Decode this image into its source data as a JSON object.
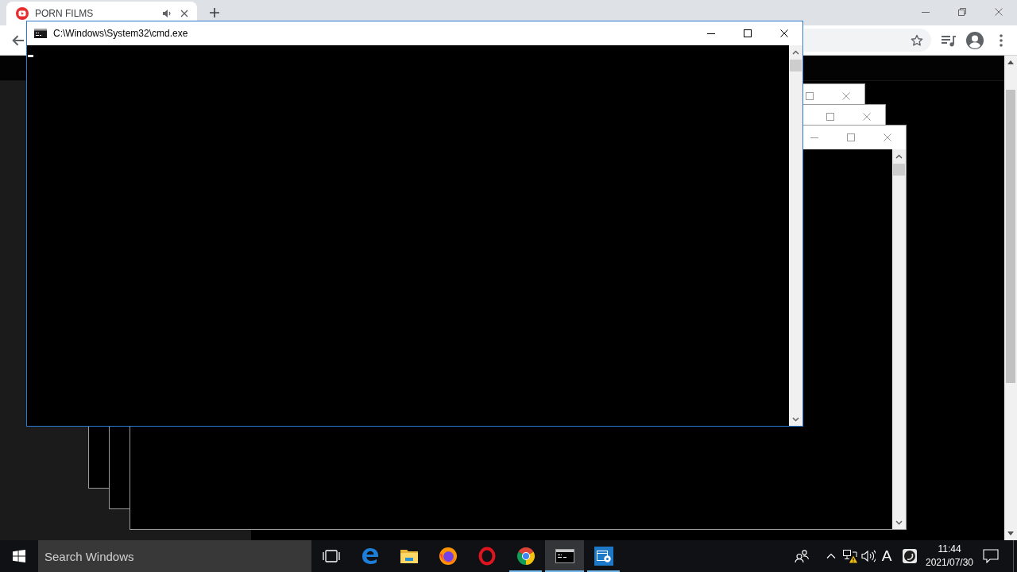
{
  "browser": {
    "tabs": [
      {
        "title": "PORN FILMS",
        "selected": true,
        "audible": true
      }
    ]
  },
  "windows": [
    {
      "focused": false
    },
    {
      "focused": false
    },
    {
      "focused": false
    },
    {
      "title": "C:\\Windows\\System32\\cmd.exe",
      "focused": true
    }
  ],
  "taskbar": {
    "search": {
      "placeholder": "Search Windows"
    },
    "apps": [
      {
        "kind": "browser_e",
        "running": false,
        "selected": false
      },
      {
        "kind": "folder",
        "running": false,
        "selected": false
      },
      {
        "kind": "browser_fox",
        "running": false,
        "selected": false
      },
      {
        "kind": "browser_o",
        "running": false,
        "selected": false
      },
      {
        "kind": "browser_circle",
        "running": true,
        "selected": false
      },
      {
        "kind": "terminal",
        "running": true,
        "selected": true
      },
      {
        "kind": "settings_window",
        "running": true,
        "selected": false
      }
    ],
    "tray": {
      "input_indicator": "A",
      "time": "11:44",
      "date": "2021/07/30"
    }
  }
}
